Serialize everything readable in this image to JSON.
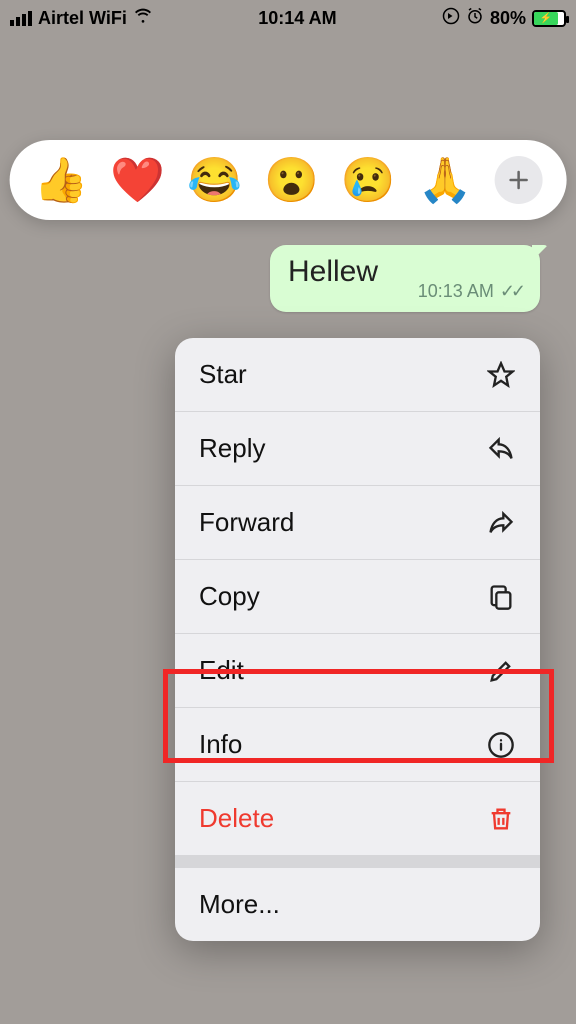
{
  "status_bar": {
    "carrier": "Airtel WiFi",
    "time": "10:14 AM",
    "battery_percent": "80%"
  },
  "reactions": {
    "items": [
      "👍",
      "❤️",
      "😂",
      "😮",
      "😢",
      "🙏"
    ],
    "plus_label": "+"
  },
  "message": {
    "text": "Hellew",
    "time": "10:13 AM"
  },
  "menu": {
    "star": "Star",
    "reply": "Reply",
    "forward": "Forward",
    "copy": "Copy",
    "edit": "Edit",
    "info": "Info",
    "delete": "Delete",
    "more": "More..."
  }
}
